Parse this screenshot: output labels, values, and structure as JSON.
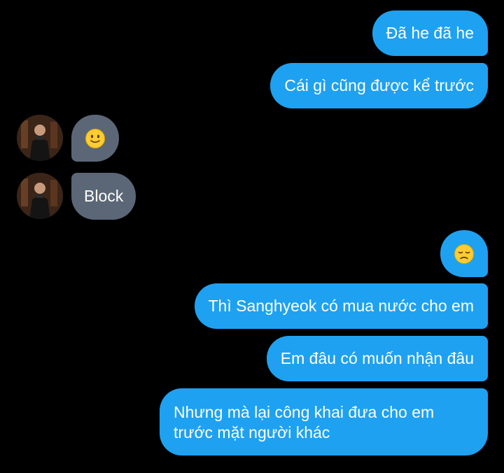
{
  "messages": [
    {
      "side": "out",
      "text": "Đã he đã he"
    },
    {
      "side": "out",
      "text": "Cái gì cũng được kể trước"
    },
    {
      "side": "in",
      "emoji": "slightly-smiling-face"
    },
    {
      "side": "in",
      "text": "Block"
    },
    {
      "side": "out",
      "emoji": "disappointed-face"
    },
    {
      "side": "out",
      "text": "Thì Sanghyeok có mua nước cho em"
    },
    {
      "side": "out",
      "text": "Em đâu có muốn nhận đâu"
    },
    {
      "side": "out",
      "text": "Nhưng mà lại công khai đưa cho em trước mặt người khác"
    }
  ],
  "colors": {
    "outgoing_bubble": "#1ea1f1",
    "incoming_bubble": "#5b6777",
    "background": "#000000",
    "text": "#ffffff"
  }
}
